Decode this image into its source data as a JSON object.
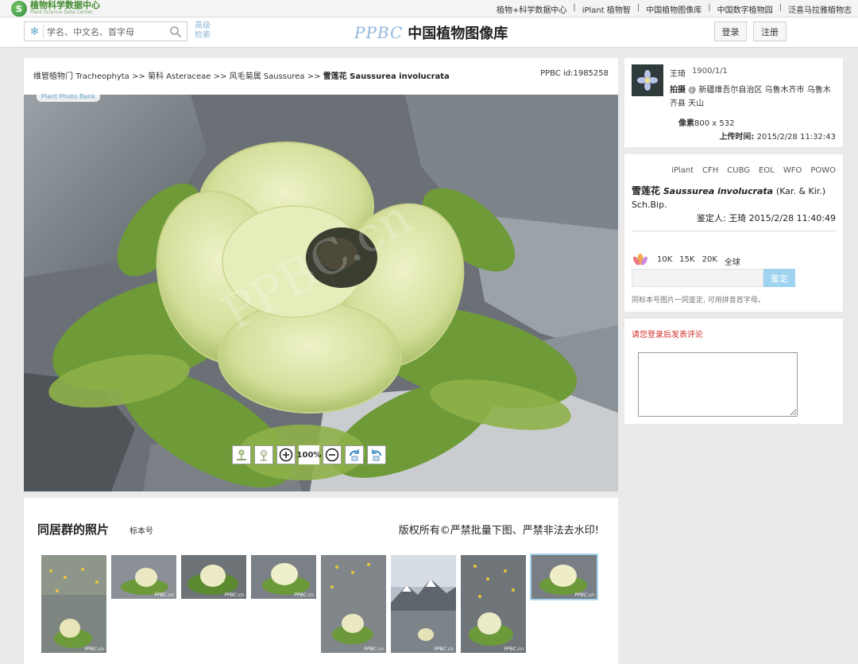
{
  "topbar": {
    "logo_cn": "植物科学数据中心",
    "logo_en": "Plant Science Data Center",
    "links": [
      "植物+科学数据中心",
      "iPlant 植物智",
      "中国植物图像库",
      "中国数字植物园",
      "泛喜马拉雅植物志"
    ],
    "separator": "|"
  },
  "header": {
    "search_placeholder": "学名、中文名、首字母",
    "advanced_search": "高级检索",
    "brand_ppbc": "PPBC",
    "brand_title": "中国植物图像库",
    "login": "登录",
    "register": "注册"
  },
  "breadcrumb": {
    "items": [
      "维管植物门 Tracheophyta",
      "菊科 Asteraceae",
      "风毛菊属 Saussurea"
    ],
    "sep": ">>",
    "current": "雪莲花 Saussurea involucrata"
  },
  "photo": {
    "ppbc_id": "PPBC id:1985258",
    "overlay_tab": "Plant Photo Bank",
    "watermark": "PPBC.cn",
    "zoom": "100%",
    "tools": [
      "fit-width-icon",
      "fit-height-icon",
      "zoom-in-icon",
      "zoom-out-icon",
      "rotate-left-icon",
      "rotate-right-icon"
    ]
  },
  "photographer": {
    "name": "王琦",
    "date": "1900/1/1",
    "shoot_label": "拍摄",
    "shoot_location": "@ 新疆维吾尔自治区 乌鲁木齐市 乌鲁木齐县 天山",
    "pixels_label": "像素",
    "pixels": "800 x 532",
    "upload_label": "上传时间:",
    "upload_time": "2015/2/28 11:32:43"
  },
  "species": {
    "sources": [
      "iPlant",
      "CFH",
      "CUBG",
      "EOL",
      "WFO",
      "POWO"
    ],
    "cn_name": "雪莲花",
    "latin": "Saussurea involucrata",
    "author": "(Kar. & Kir.) Sch.Bip.",
    "identifier_label": "鉴定人:",
    "identifier": "王琦 2015/2/28 11:40:49",
    "counts": [
      "10K",
      "15K",
      "20K",
      "全球"
    ],
    "identify_button": "鉴定",
    "hint": "同标本号图片一同鉴定, 可用拼音首字母。"
  },
  "comments": {
    "login_note": "请您登录后发表评论"
  },
  "gallery": {
    "title": "同居群的照片",
    "tag": "标本号",
    "copyright": "版权所有©严禁批量下图、严禁非法去水印!",
    "watermark": "PPBC.cn",
    "selected_index": 7,
    "thumb_count": 8
  },
  "colors": {
    "accent_blue": "#9fd3ef",
    "brand_blue": "#8fb6dc",
    "warning_red": "#d0302a",
    "logo_green": "#3d8a2a"
  }
}
